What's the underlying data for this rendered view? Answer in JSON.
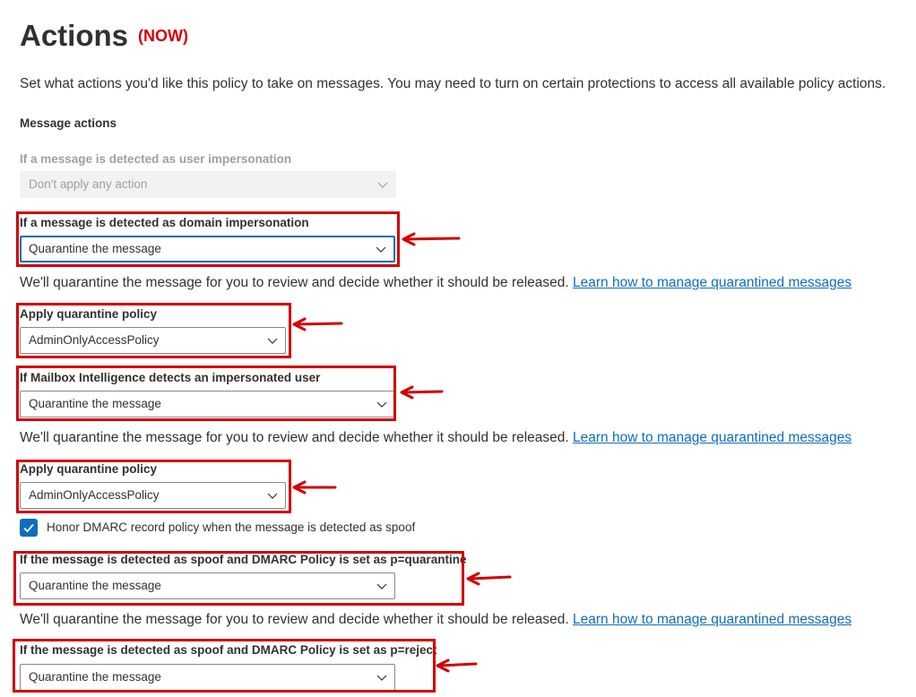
{
  "header": {
    "title": "Actions",
    "badge": "(NOW)"
  },
  "description": "Set what actions you'd like this policy to take on messages. You may need to turn on certain protections to access all available policy actions.",
  "section_title": "Message actions",
  "user_impersonation": {
    "label": "If a message is detected as user impersonation",
    "value": "Don't apply any action"
  },
  "domain_impersonation": {
    "label": "If a message is detected as domain impersonation",
    "value": "Quarantine the message"
  },
  "info_text": "We'll quarantine the message for you to review and decide whether it should be released.",
  "info_link": "Learn how to manage quarantined messages",
  "quarantine_policy_1": {
    "label": "Apply quarantine policy",
    "value": "AdminOnlyAccessPolicy"
  },
  "mailbox_intelligence": {
    "label": "If Mailbox Intelligence detects an impersonated user",
    "value": "Quarantine the message"
  },
  "quarantine_policy_2": {
    "label": "Apply quarantine policy",
    "value": "AdminOnlyAccessPolicy"
  },
  "honor_dmarc": {
    "label": "Honor DMARC record policy when the message is detected as spoof",
    "checked": true
  },
  "dmarc_quarantine": {
    "label": "If the message is detected as spoof and DMARC Policy is set as p=quarantine",
    "value": "Quarantine the message"
  },
  "dmarc_reject": {
    "label": "If the message is detected as spoof and DMARC Policy is set as p=reject",
    "value": "Quarantine the message"
  },
  "colors": {
    "accent": "#0f6cbd",
    "annotation": "#d40000",
    "text": "#323130",
    "disabled": "#a19f9d"
  },
  "icons": {
    "dropdown": "chevron-down-icon",
    "checkbox": "checkmark-icon",
    "annotation": "arrow-left-icon"
  }
}
